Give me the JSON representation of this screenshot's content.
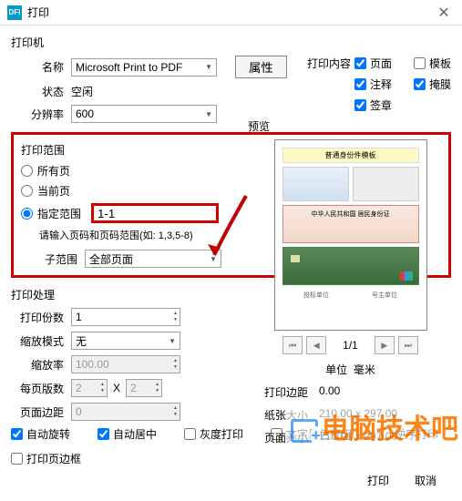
{
  "window": {
    "title": "打印"
  },
  "printer": {
    "section": "打印机",
    "name_label": "名称",
    "name_value": "Microsoft Print to PDF",
    "props_btn": "属性",
    "status_label": "状态",
    "status_value": "空闲",
    "res_label": "分辨率",
    "res_value": "600",
    "content_label": "打印内容",
    "page_chk": "页面",
    "template_chk": "模板",
    "annot_chk": "注释",
    "mask_chk": "掩膜",
    "stamp_chk": "签章"
  },
  "scope": {
    "section": "打印范围",
    "all": "所有页",
    "current": "当前页",
    "range": "指定范围",
    "range_value": "1-1",
    "hint": "请输入页码和页码范围(如: 1,3,5-8)",
    "sub_label": "子范围",
    "sub_value": "全部页面"
  },
  "preview": {
    "section": "预览",
    "panel_title": "普通身份件模板",
    "id_text": "中华人民共和国 居民身份证",
    "cap1": "投标单位",
    "cap2": "号主单位",
    "page": "1/1",
    "unit_label": "单位",
    "unit_value": "毫米",
    "margin_label": "打印边距",
    "margin_value": "0.00",
    "paper_label": "纸张大小",
    "paper_value": "210.00 x 297.00",
    "pagesize_label": "页面大小",
    "pagesize_value": "210.01 x 297.00"
  },
  "process": {
    "section": "打印处理",
    "copies_label": "打印份数",
    "copies_value": "1",
    "scale_label": "缩放模式",
    "scale_value": "无",
    "ratio_label": "缩放率",
    "ratio_value": "100.00",
    "perpage_label": "每页版数",
    "perpage_a": "2",
    "perpage_x": "X",
    "perpage_b": "2",
    "margin_label": "页面边距",
    "margin_value": "0",
    "auto_rotate": "自动旋转",
    "auto_center": "自动居中",
    "gray": "灰度打印",
    "black_text": "文字黑色打印",
    "reverse": "逆序打印",
    "page_border": "打印页边框"
  },
  "footer": {
    "print": "打印",
    "cancel": "取消"
  },
  "watermark": "电脑技术吧"
}
